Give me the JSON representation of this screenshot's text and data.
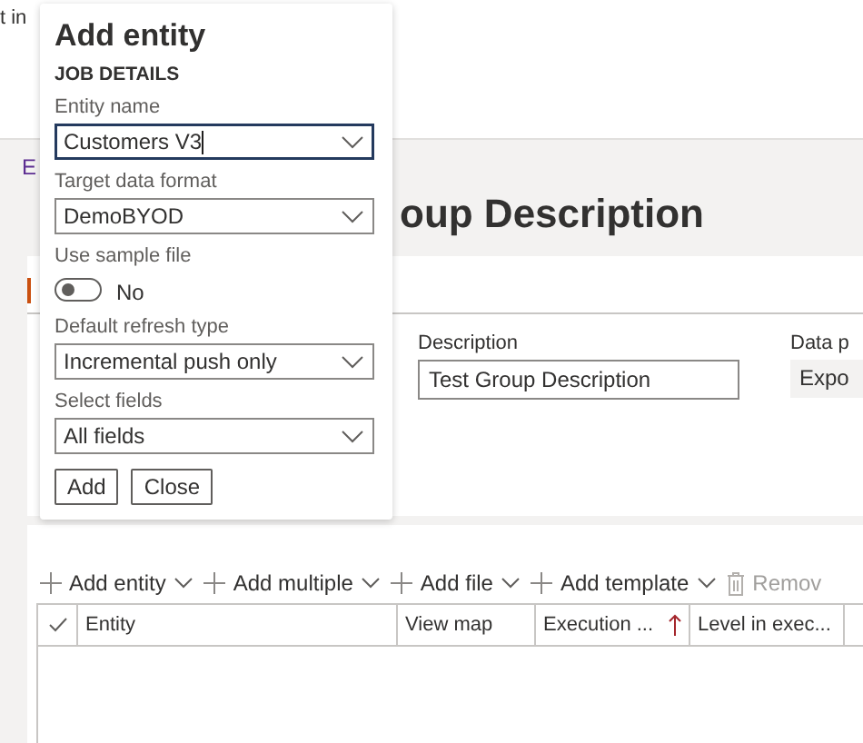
{
  "page": {
    "top_text": "t in",
    "breadcrumb": "E",
    "title_right": "oup Description",
    "fields": [
      {
        "label": "Description",
        "value": "Test Group Description",
        "kind": "input"
      },
      {
        "label": "Data p",
        "value": "Expo",
        "kind": "readonly"
      }
    ],
    "toolbar": [
      {
        "label": "Add entity",
        "kind": "add",
        "dropdown": true,
        "disabled": false
      },
      {
        "label": "Add multiple",
        "kind": "add",
        "dropdown": true,
        "disabled": false
      },
      {
        "label": "Add file",
        "kind": "add",
        "dropdown": true,
        "disabled": false
      },
      {
        "label": "Add template",
        "kind": "add",
        "dropdown": true,
        "disabled": false
      },
      {
        "label": "Remov",
        "kind": "delete",
        "dropdown": false,
        "disabled": true
      }
    ],
    "grid": {
      "columns": [
        {
          "label": "Entity",
          "sorted": false
        },
        {
          "label": "View map",
          "sorted": false
        },
        {
          "label": "Execution ...",
          "sorted": true
        },
        {
          "label": "Level in exec...",
          "sorted": false
        }
      ]
    }
  },
  "dialog": {
    "title": "Add entity",
    "section": "JOB DETAILS",
    "fields": [
      {
        "kind": "combo",
        "label": "Entity name",
        "value": "Customers V3",
        "focused": true
      },
      {
        "kind": "combo",
        "label": "Target data format",
        "value": "DemoBYOD",
        "focused": false
      },
      {
        "kind": "toggle",
        "label": "Use sample file",
        "on": false,
        "value": "No"
      },
      {
        "kind": "combo",
        "label": "Default refresh type",
        "value": "Incremental push only",
        "focused": false
      },
      {
        "kind": "combo",
        "label": "Select fields",
        "value": "All fields",
        "focused": false
      }
    ],
    "buttons": [
      "Add",
      "Close"
    ]
  }
}
